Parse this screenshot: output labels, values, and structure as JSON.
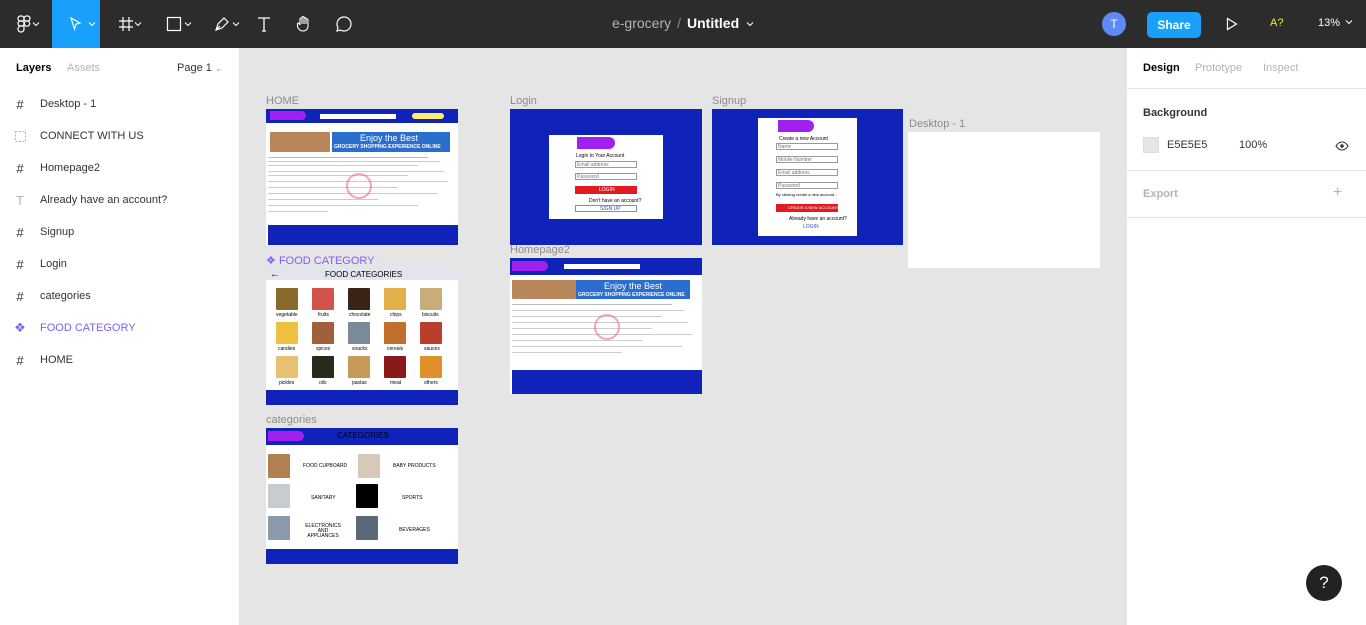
{
  "toolbar": {
    "tools": [
      "figma-menu-icon",
      "move-icon",
      "frame-icon",
      "rectangle-icon",
      "pen-icon",
      "text-icon",
      "hand-icon",
      "comment-icon"
    ],
    "project": "e-grocery",
    "separator": "/",
    "document": "Untitled",
    "avatar_initial": "T",
    "share_label": "Share",
    "a11y_label": "A?",
    "zoom_label": "13%"
  },
  "left_panel": {
    "tab_layers": "Layers",
    "tab_assets": "Assets",
    "page": "Page 1",
    "layers": [
      {
        "label": "Desktop - 1",
        "type": "frame"
      },
      {
        "label": "CONNECT WITH US",
        "type": "group"
      },
      {
        "label": "Homepage2",
        "type": "frame"
      },
      {
        "label": "Already have an account?",
        "type": "text"
      },
      {
        "label": "Signup",
        "type": "frame"
      },
      {
        "label": "Login",
        "type": "frame"
      },
      {
        "label": "categories",
        "type": "frame"
      },
      {
        "label": "FOOD CATEGORY",
        "type": "component"
      },
      {
        "label": "HOME",
        "type": "frame"
      }
    ]
  },
  "right_panel": {
    "tab_design": "Design",
    "tab_prototype": "Prototype",
    "tab_inspect": "Inspect",
    "background_heading": "Background",
    "background_hex": "E5E5E5",
    "background_color": "#E5E5E5",
    "background_opacity": "100%",
    "export_heading": "Export"
  },
  "canvas": {
    "frames": {
      "home": "HOME",
      "food_category": "FOOD CATEGORY",
      "categories": "categories",
      "login": "Login",
      "signup": "Signup",
      "homepage2": "Homepage2",
      "desktop1": "Desktop - 1"
    },
    "home_banner_title": "Enjoy the Best",
    "home_banner_sub": "GROCERY SHOPPING EXPERIENCE ONLINE",
    "food_categories_title": "FOOD CATEGORIES",
    "food_items": [
      "vegetable",
      "fruits",
      "chocolate",
      "chips",
      "biscuits",
      "candies",
      "spices",
      "snacks",
      "cereals",
      "sauces",
      "pickles",
      "oils",
      "pastas",
      "meat",
      "others"
    ],
    "categories_title": "CATEGORIES",
    "category_items": [
      "FOOD CUPBOARD",
      "BABY PRODUCTS",
      "SANITARY",
      "SPORTS",
      "ELECTRONICS AND APPLIANCES",
      "BEVERAGES"
    ],
    "login_heading": "Login to Your Account",
    "login_email": "Email address",
    "login_password": "Password",
    "login_button": "LOGIN",
    "login_noacct": "Don't have an account?",
    "login_signup": "SIGN UP",
    "signup_heading": "Create a new Account",
    "signup_name": "Name",
    "signup_mobile": "Mobile Number",
    "signup_email": "Email address",
    "signup_password": "Password",
    "signup_terms": "By clicking create a new account...",
    "signup_button": "CREATE A NEW ACCOUNT",
    "signup_have": "Already have an account?",
    "signup_login": "LOGIN"
  },
  "colors": {
    "toolbar_bg": "#2C2C2C",
    "accent": "#18A0FB",
    "component": "#7B61FF",
    "frame_blue": "#1023B8",
    "canvas_bg": "#E5E5E5"
  }
}
